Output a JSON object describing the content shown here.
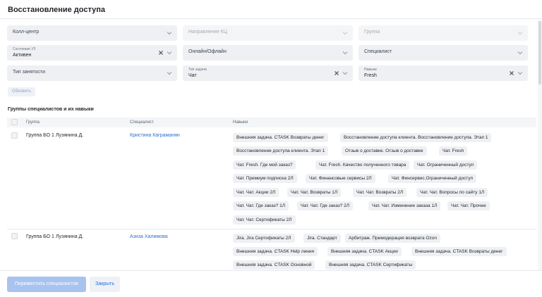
{
  "modal": {
    "title": "Восстановление доступа"
  },
  "filters": {
    "call_center": {
      "placeholder": "Колл-центр"
    },
    "kc_direction": {
      "placeholder": "Направление КЦ"
    },
    "group": {
      "placeholder": "Группа"
    },
    "uz_state": {
      "label": "Состояние УЗ",
      "value": "Активен"
    },
    "online_offline": {
      "placeholder": "Онлайн/Офлайн"
    },
    "specialist": {
      "placeholder": "Специалист"
    },
    "employment_type": {
      "placeholder": "Тип занятости"
    },
    "task_type": {
      "label": "Тип задачи",
      "value": "Чат"
    },
    "skills": {
      "label": "Навыки",
      "value": "Fresh"
    }
  },
  "refresh_label": "Обновить",
  "section_title": "Группы специалистов и их навыки",
  "table": {
    "headers": {
      "group": "Группа",
      "specialist": "Специалист",
      "skills": "Навыки"
    },
    "rows": [
      {
        "group": "Группа БО 1 Лузянина Д.",
        "specialist": "Кристина Каграманян",
        "skills": [
          "Внешняя задача. CTASK Возвраты денег",
          "Восстановление доступа клиента. Восстановление доступа. Этап 1",
          "Восстановление доступа клиента. Этап 1",
          "Отзыв о доставке. Отзыв о доставке",
          "Чат. Fresh",
          "Чат. Fresh. Где мой заказ?",
          "Чат. Fresh. Качество полученного товара",
          "Чат. Ограниченный доступ",
          "Чат. Премиум подписка 2Л",
          "Чат. Финансовые сервисы 2Л",
          "Чат. Финсервис.Ограниченный доступ",
          "Чат. Чат. Акции 2Л",
          "Чат. Чат. Возвраты 1Л",
          "Чат. Чат. Возвраты 2Л",
          "Чат. Чат. Вопросы по сайту 1Л",
          "Чат. Чат. Где заказ? 1Л",
          "Чат. Чат. Где заказ? 2Л",
          "Чат. Чат. Изменение заказа 1Л",
          "Чат. Чат. Прочее",
          "Чат. Чат. Сертификаты 2Л"
        ]
      },
      {
        "group": "Группа БО 1 Лузянина Д.",
        "specialist": "Азиза Халимова",
        "skills": [
          "Jira. Jira Сертификаты 2Л",
          "Jira. Стандарт",
          "Арбитраж. Премодерация возврата Ozon",
          "Внешняя задача. CTASK Help линия",
          "Внешняя задача. CTASK Акции",
          "Внешняя задача. CTASK Возвраты денег",
          "Внешняя задача. CTASK Основной",
          "Внешняя задача. CTASK Сертификаты"
        ]
      }
    ]
  },
  "footer": {
    "move_label": "Переместить специалистов",
    "close_label": "Закрыть"
  },
  "colors": {
    "accent": "#2b6fd6",
    "accent_disabled": "#a9c3f0",
    "field_bg": "#eef0f3"
  }
}
